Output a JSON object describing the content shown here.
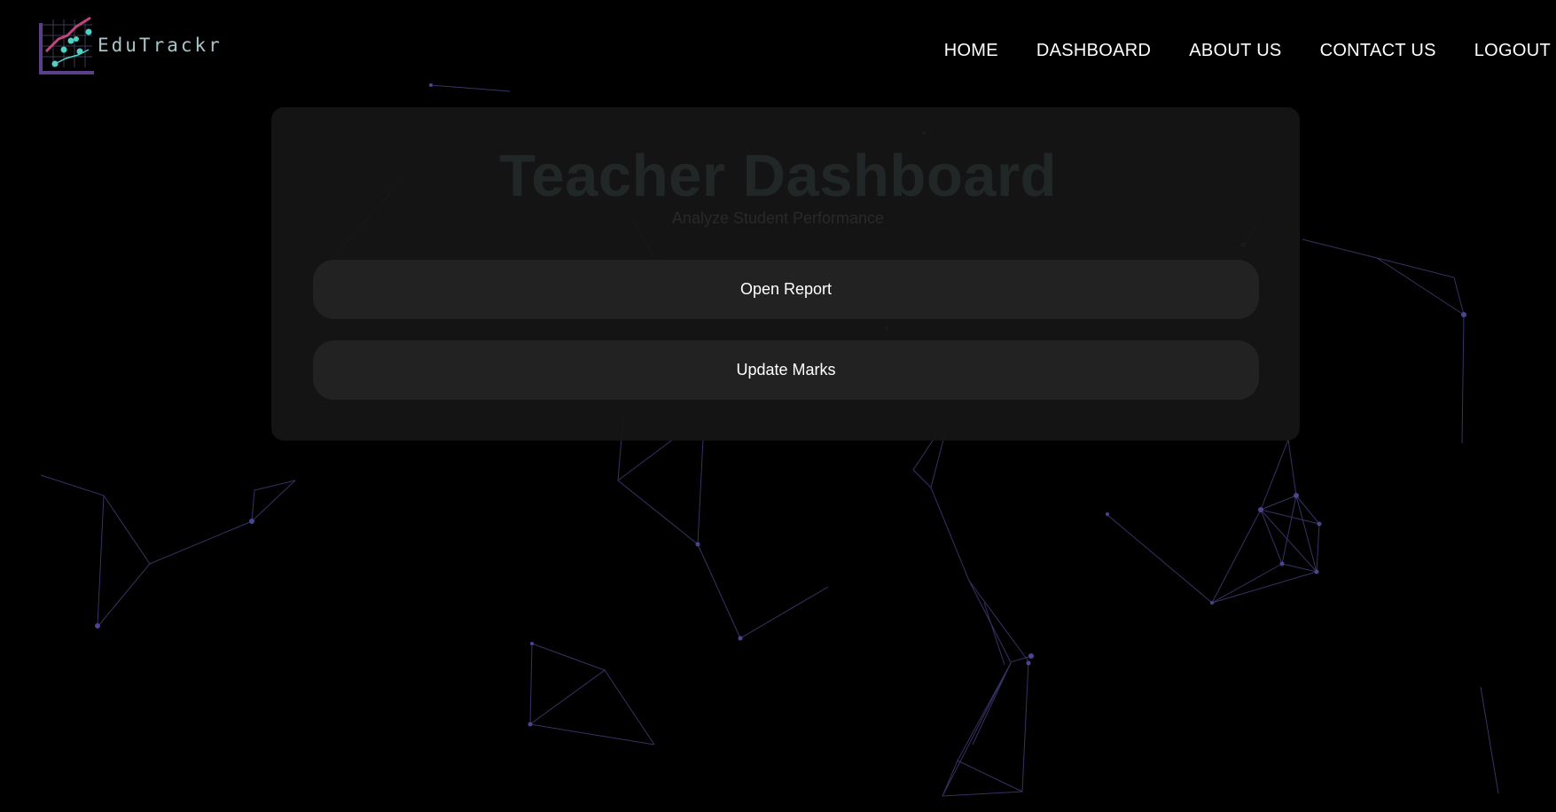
{
  "header": {
    "logo_text": "EduTrackr",
    "nav": [
      {
        "label": "HOME"
      },
      {
        "label": "DASHBOARD"
      },
      {
        "label": "ABOUT US"
      },
      {
        "label": "CONTACT US"
      },
      {
        "label": "LOGOUT"
      }
    ]
  },
  "main": {
    "title": "Teacher Dashboard",
    "subtitle": "Analyze Student Performance",
    "buttons": [
      {
        "label": "Open Report"
      },
      {
        "label": "Update Marks"
      }
    ]
  },
  "theme": {
    "background": "#000000",
    "card": "#161616",
    "button": "#222222",
    "accent": "#a3e4f0",
    "network_line": "#3d3870",
    "logo_purple": "#5a3f8c",
    "logo_pink": "#c2457f",
    "logo_teal": "#4fd1c5"
  }
}
